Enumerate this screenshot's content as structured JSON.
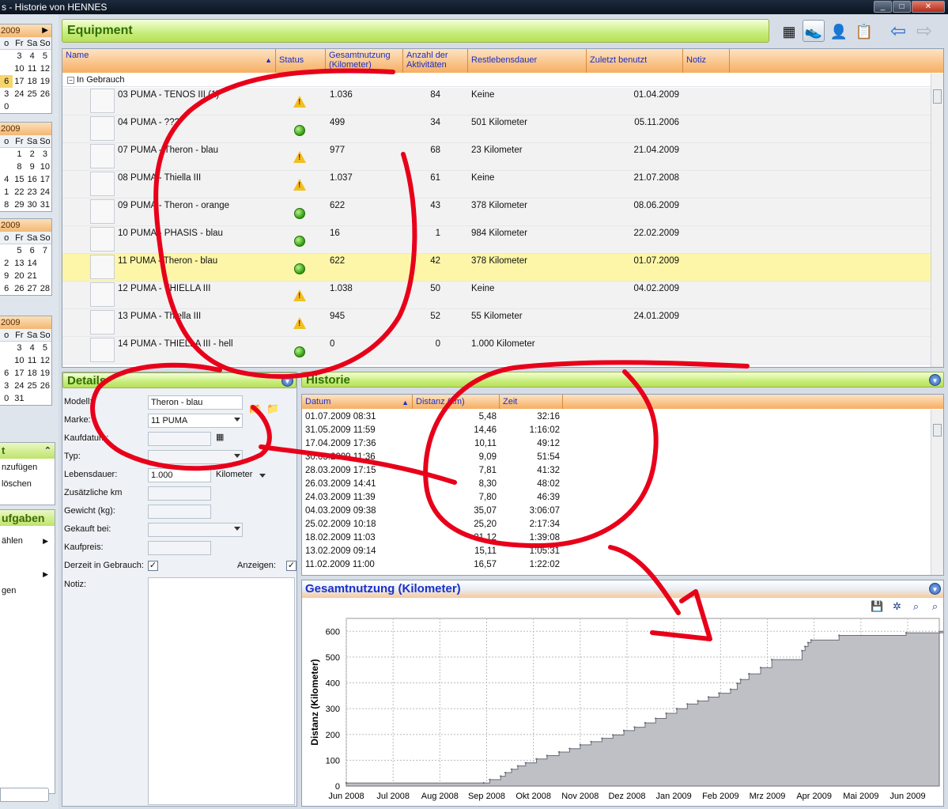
{
  "window": {
    "title": "s - Historie von HENNES",
    "min": "_",
    "max": "□",
    "close": "✕"
  },
  "calendars": [
    {
      "header": "2009",
      "dows": [
        "o",
        "Fr",
        "Sa",
        "So"
      ],
      "rows": [
        [
          "",
          "3",
          "4",
          "5"
        ],
        [
          "",
          "10",
          "11",
          "12"
        ],
        [
          "6",
          "17",
          "18",
          "19"
        ],
        [
          "3",
          "24",
          "25",
          "26"
        ],
        [
          "0",
          "",
          "",
          ""
        ]
      ],
      "today": "6"
    },
    {
      "header": "2009",
      "dows": [
        "o",
        "Fr",
        "Sa",
        "So"
      ],
      "rows": [
        [
          "",
          "1",
          "2",
          "3"
        ],
        [
          "",
          "8",
          "9",
          "10"
        ],
        [
          "4",
          "15",
          "16",
          "17"
        ],
        [
          "1",
          "22",
          "23",
          "24"
        ],
        [
          "8",
          "29",
          "30",
          "31"
        ]
      ]
    },
    {
      "header": "2009",
      "dows": [
        "o",
        "Fr",
        "Sa",
        "So"
      ],
      "rows": [
        [
          "",
          "5",
          "6",
          "7"
        ],
        [
          "2",
          "13",
          "14",
          ""
        ],
        [
          "9",
          "20",
          "21",
          ""
        ],
        [
          "6",
          "26",
          "27",
          "28"
        ]
      ]
    },
    {
      "header": "2009",
      "dows": [
        "o",
        "Fr",
        "Sa",
        "So"
      ],
      "rows": [
        [
          "",
          "3",
          "4",
          "5"
        ],
        [
          "",
          "10",
          "11",
          "12"
        ],
        [
          "6",
          "17",
          "18",
          "19"
        ],
        [
          "3",
          "24",
          "25",
          "26"
        ],
        [
          "0",
          "31",
          "",
          ""
        ]
      ]
    }
  ],
  "sidebox1": {
    "title": "t",
    "items": [
      "nzufügen",
      "löschen"
    ]
  },
  "sidebox2": {
    "title": "ufgaben",
    "items": [
      "ählen",
      "",
      "gen"
    ]
  },
  "equipment": {
    "title": "Equipment",
    "columns": [
      "Name",
      "Status",
      "Gesamtnutzung (Kilometer)",
      "Anzahl der Aktivitäten",
      "Restlebensdauer",
      "Zuletzt benutzt",
      "Notiz"
    ],
    "group": "In Gebrauch",
    "rows": [
      {
        "name": "03 PUMA - TENOS III (1)",
        "status": "warn",
        "km": "1.036",
        "acts": "84",
        "rest": "Keine",
        "last": "01.04.2009"
      },
      {
        "name": "04 PUMA - ???",
        "status": "ok",
        "km": "499",
        "acts": "34",
        "rest": "501 Kilometer",
        "last": "05.11.2006"
      },
      {
        "name": "07 PUMA - Theron - blau",
        "status": "warn",
        "km": "977",
        "acts": "68",
        "rest": "23 Kilometer",
        "last": "21.04.2009"
      },
      {
        "name": "08 PUMA - Thiella III",
        "status": "warn",
        "km": "1.037",
        "acts": "61",
        "rest": "Keine",
        "last": "21.07.2008"
      },
      {
        "name": "09 PUMA - Theron - orange",
        "status": "ok",
        "km": "622",
        "acts": "43",
        "rest": "378 Kilometer",
        "last": "08.06.2009"
      },
      {
        "name": "10 PUMA - PHASIS - blau",
        "status": "ok",
        "km": "16",
        "acts": "1",
        "rest": "984 Kilometer",
        "last": "22.02.2009"
      },
      {
        "name": "11 PUMA - Theron - blau",
        "status": "ok",
        "km": "622",
        "acts": "42",
        "rest": "378 Kilometer",
        "last": "01.07.2009",
        "selected": true
      },
      {
        "name": "12 PUMA - THIELLA III",
        "status": "warn",
        "km": "1.038",
        "acts": "50",
        "rest": "Keine",
        "last": "04.02.2009"
      },
      {
        "name": "13 PUMA - Thiella III",
        "status": "warn",
        "km": "945",
        "acts": "52",
        "rest": "55 Kilometer",
        "last": "24.01.2009"
      },
      {
        "name": "14 PUMA - THIELLA III - hell",
        "status": "ok",
        "km": "0",
        "acts": "0",
        "rest": "1.000 Kilometer",
        "last": ""
      }
    ]
  },
  "details": {
    "title": "Details",
    "modell_label": "Modell:",
    "modell": "Theron - blau",
    "marke_label": "Marke:",
    "marke": "11 PUMA",
    "kaufdatum_label": "Kaufdatum:",
    "typ_label": "Typ:",
    "lebensdauer_label": "Lebensdauer:",
    "lebensdauer": "1.000",
    "lebensdauer_unit": "Kilometer",
    "zusatz_label": "Zusätzliche km",
    "gewicht_label": "Gewicht (kg):",
    "gekauft_label": "Gekauft bei:",
    "kaufpreis_label": "Kaufpreis:",
    "gebrauch_label": "Derzeit in Gebrauch:",
    "anzeigen_label": "Anzeigen:",
    "notiz_label": "Notiz:",
    "check": "✓"
  },
  "historie": {
    "title": "Historie",
    "columns": [
      "Datum",
      "Distanz (km)",
      "Zeit"
    ],
    "rows": [
      [
        "01.07.2009 08:31",
        "5,48",
        "32:16"
      ],
      [
        "31.05.2009 11:59",
        "14,46",
        "1:16:02"
      ],
      [
        "17.04.2009 17:36",
        "10,11",
        "49:12"
      ],
      [
        "30.03.2009 11:36",
        "9,09",
        "51:54"
      ],
      [
        "28.03.2009 17:15",
        "7,81",
        "41:32"
      ],
      [
        "26.03.2009 14:41",
        "8,30",
        "48:02"
      ],
      [
        "24.03.2009 11:39",
        "7,80",
        "46:39"
      ],
      [
        "04.03.2009 09:38",
        "35,07",
        "3:06:07"
      ],
      [
        "25.02.2009 10:18",
        "25,20",
        "2:17:34"
      ],
      [
        "18.02.2009 11:03",
        "21,12",
        "1:39:08"
      ],
      [
        "13.02.2009 09:14",
        "15,11",
        "1:05:31"
      ],
      [
        "11.02.2009 11:00",
        "16,57",
        "1:22:02"
      ]
    ]
  },
  "chart_data": {
    "type": "area",
    "title": "Gesamtnutzung (Kilometer)",
    "xlabel": "",
    "ylabel": "Distanz (Kilometer)",
    "x_ticks": [
      "Jun 2008",
      "Jul 2008",
      "Aug 2008",
      "Sep 2008",
      "Okt 2008",
      "Nov 2008",
      "Dez 2008",
      "Jan 2009",
      "Feb 2009",
      "Mrz 2009",
      "Apr 2009",
      "Mai 2009",
      "Jun 2009"
    ],
    "ylim": [
      0,
      650
    ],
    "y_ticks": [
      0,
      100,
      200,
      300,
      400,
      500,
      600
    ],
    "grid": true,
    "x": [
      "01.06.2008",
      "30.08.2008",
      "03.09.2008",
      "10.09.2008",
      "13.09.2008",
      "17.09.2008",
      "21.09.2008",
      "26.09.2008",
      "03.10.2008",
      "10.10.2008",
      "18.10.2008",
      "25.10.2008",
      "01.11.2008",
      "08.11.2008",
      "15.11.2008",
      "22.11.2008",
      "29.11.2008",
      "06.12.2008",
      "13.12.2008",
      "20.12.2008",
      "27.12.2008",
      "03.01.2009",
      "10.01.2009",
      "17.01.2009",
      "24.01.2009",
      "31.01.2009",
      "07.02.2009",
      "11.02.2009",
      "13.02.2009",
      "18.02.2009",
      "25.02.2009",
      "04.03.2009",
      "24.03.2009",
      "26.03.2009",
      "28.03.2009",
      "30.03.2009",
      "17.04.2009",
      "31.05.2009",
      "01.07.2009"
    ],
    "values": [
      12,
      12,
      25,
      38,
      52,
      65,
      78,
      90,
      105,
      118,
      132,
      145,
      160,
      172,
      185,
      198,
      215,
      228,
      245,
      262,
      282,
      300,
      318,
      330,
      345,
      360,
      375,
      398,
      413,
      435,
      459,
      490,
      525,
      541,
      556,
      566,
      584,
      594,
      600
    ]
  },
  "annotation_color": "#e8001a"
}
